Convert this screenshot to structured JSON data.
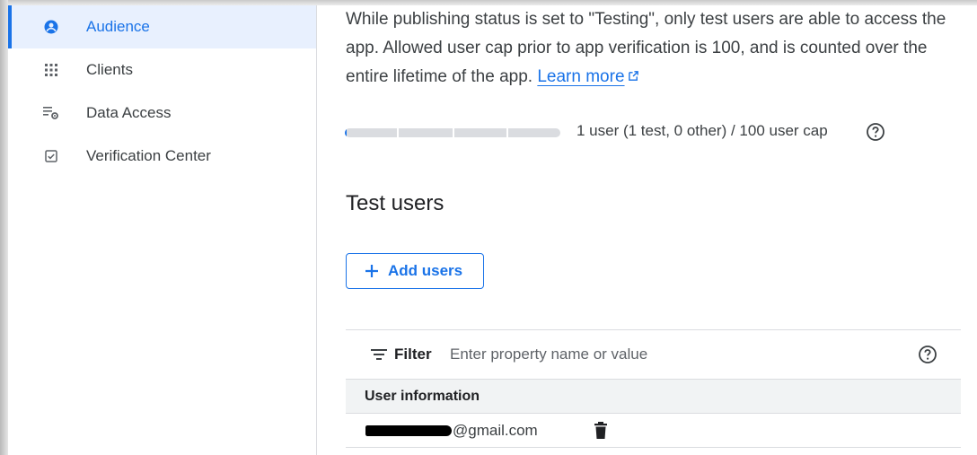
{
  "sidebar": {
    "items": [
      {
        "label": "Audience",
        "icon": "account-circle-icon",
        "active": true
      },
      {
        "label": "Clients",
        "icon": "grid-icon",
        "active": false
      },
      {
        "label": "Data Access",
        "icon": "data-settings-icon",
        "active": false
      },
      {
        "label": "Verification Center",
        "icon": "checkbox-icon",
        "active": false
      }
    ]
  },
  "main": {
    "description": "While publishing status is set to \"Testing\", only test users are able to access the app. Allowed user cap prior to app verification is 100, and is counted over the entire lifetime of the app.",
    "learn_more": "Learn more",
    "user_cap": {
      "text": "1 user (1 test, 0 other) / 100 user cap",
      "used": 1,
      "cap": 100
    },
    "test_users_title": "Test users",
    "add_users_label": "Add users",
    "filter": {
      "label": "Filter",
      "placeholder": "Enter property name or value"
    },
    "table": {
      "header": "User information",
      "rows": [
        {
          "email_visible_suffix": "@gmail.com"
        }
      ]
    }
  },
  "colors": {
    "accent": "#1a73e8",
    "active_bg": "#e8f0fe",
    "text": "#3c4043",
    "border": "#dadce0"
  }
}
